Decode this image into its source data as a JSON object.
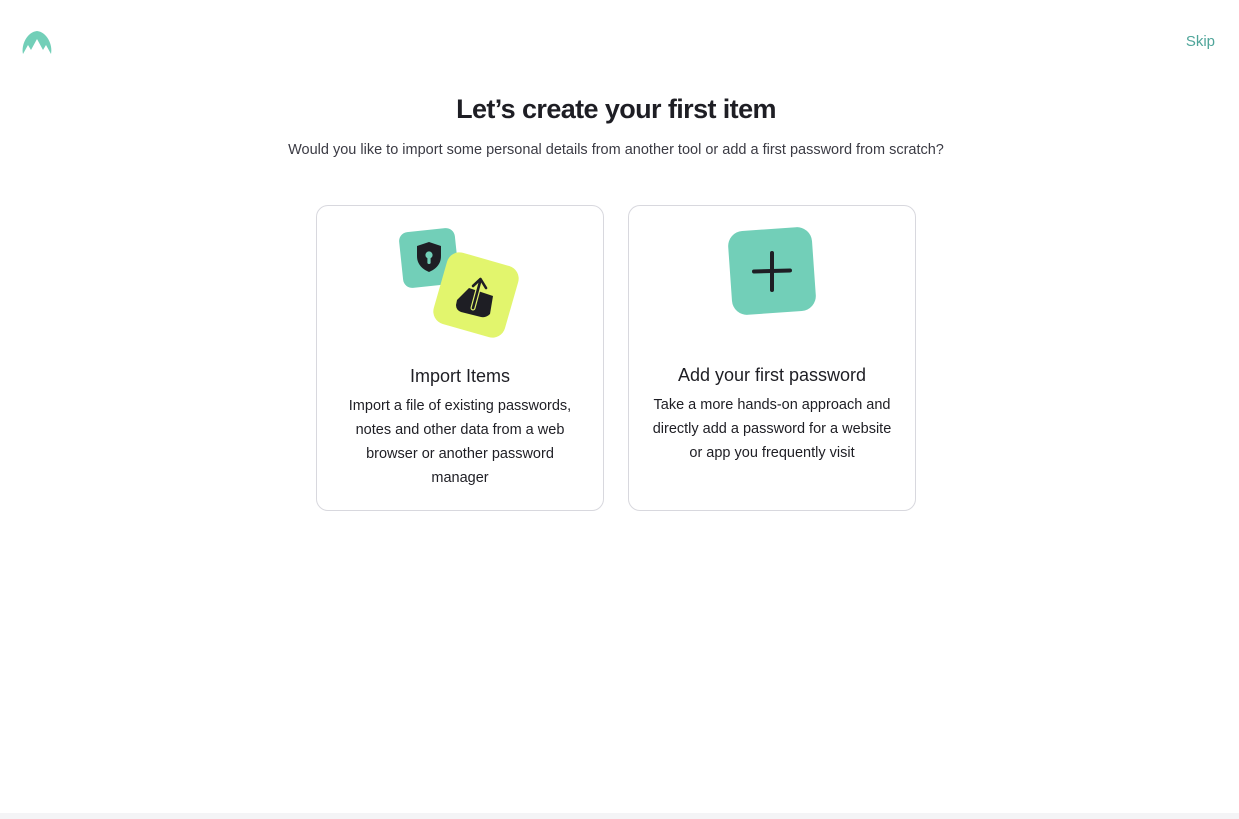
{
  "header": {
    "logo_icon": "nordpass-mountain-logo-icon",
    "skip_label": "Skip"
  },
  "main": {
    "title": "Let’s create your first item",
    "subtitle": "Would you like to import some personal details from another tool or add a first password from scratch?"
  },
  "cards": [
    {
      "title": "Import Items",
      "description": "Import a file of existing passwords, notes and other data from a web browser or another password manager",
      "icons": [
        "shield-keyhole-icon",
        "upload-box-icon"
      ]
    },
    {
      "title": "Add your first password",
      "description": "Take a more hands-on approach and directly add a password for a website or app you frequently visit",
      "icons": [
        "plus-icon"
      ]
    }
  ],
  "colors": {
    "accent_teal": "#72cfb8",
    "accent_lime": "#e2f56d",
    "link": "#4fa59a",
    "text": "#1e1e24",
    "border": "#d8d8de"
  }
}
